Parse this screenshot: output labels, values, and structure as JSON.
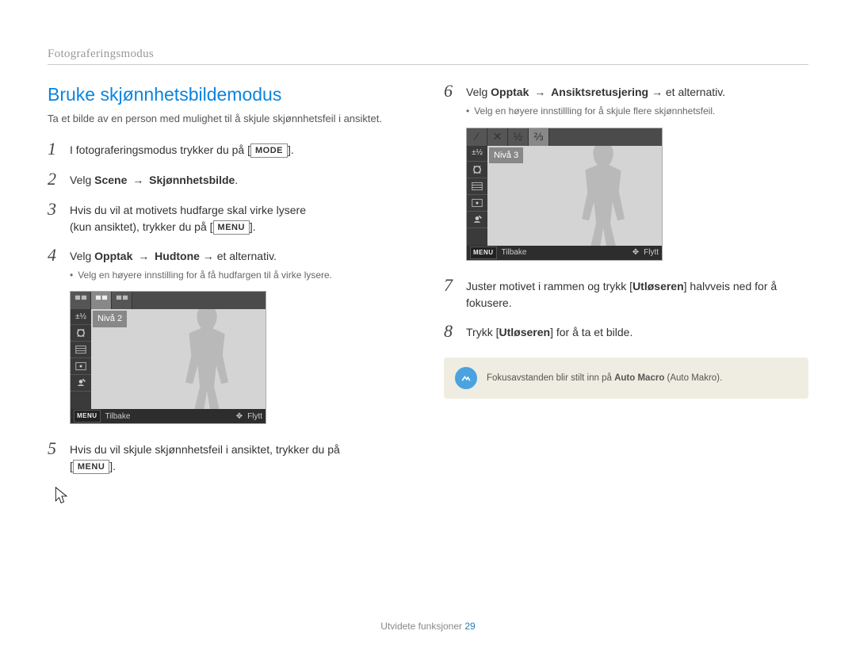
{
  "header": {
    "section": "Fotograferingsmodus"
  },
  "title": "Bruke skjønnhetsbildemodus",
  "intro": "Ta et bilde av en person med mulighet til å skjule skjønnhetsfeil i ansiktet.",
  "buttons": {
    "mode": "MODE",
    "menu": "MENU"
  },
  "steps": {
    "s1": {
      "num": "1",
      "pre": "I fotograferingsmodus trykker du på [",
      "post": "]."
    },
    "s2": {
      "num": "2",
      "pre": "Velg ",
      "bold1": "Scene",
      "arrow": "→",
      "bold2": "Skjønnhetsbilde",
      "post": "."
    },
    "s3": {
      "num": "3",
      "line1": "Hvis du vil at motivets hudfarge skal virke lysere",
      "line2_pre": "(kun ansiktet), trykker du på [",
      "line2_post": "]."
    },
    "s4": {
      "num": "4",
      "pre": "Velg ",
      "bold1": "Opptak",
      "arrow": "→",
      "bold2": "Hudtone",
      "post": " → et alternativ.",
      "bullet": "Velg en høyere innstilling for å få hudfargen til å virke lysere."
    },
    "s5": {
      "num": "5",
      "pre": "Hvis du vil skjule skjønnhetsfeil i ansiktet, trykker du på",
      "line2_pre": "[",
      "line2_post": "]."
    },
    "s6": {
      "num": "6",
      "pre": "Velg ",
      "bold1": "Opptak",
      "arrow": "→",
      "bold2": "Ansiktsretusjering",
      "post": " → et alternativ.",
      "bullet": "Velg en høyere innstillling for å skjule flere skjønnhetsfeil."
    },
    "s7": {
      "num": "7",
      "pre": "Juster motivet i rammen og trykk [",
      "bold": "Utløseren",
      "post": "] halvveis ned for å fokusere."
    },
    "s8": {
      "num": "8",
      "pre": "Trykk [",
      "bold": "Utløseren",
      "post": "] for å ta et bilde."
    }
  },
  "lcd": {
    "level2": "Nivå 2",
    "level3": "Nivå 3",
    "menu_label": "MENU",
    "back": "Tilbake",
    "move": "Flytt"
  },
  "note": {
    "pre": "Fokusavstanden blir stilt inn på ",
    "bold": "Auto Macro",
    "paren": " (Auto Makro)."
  },
  "footer": {
    "label": "Utvidete funksjoner",
    "page": "29"
  }
}
